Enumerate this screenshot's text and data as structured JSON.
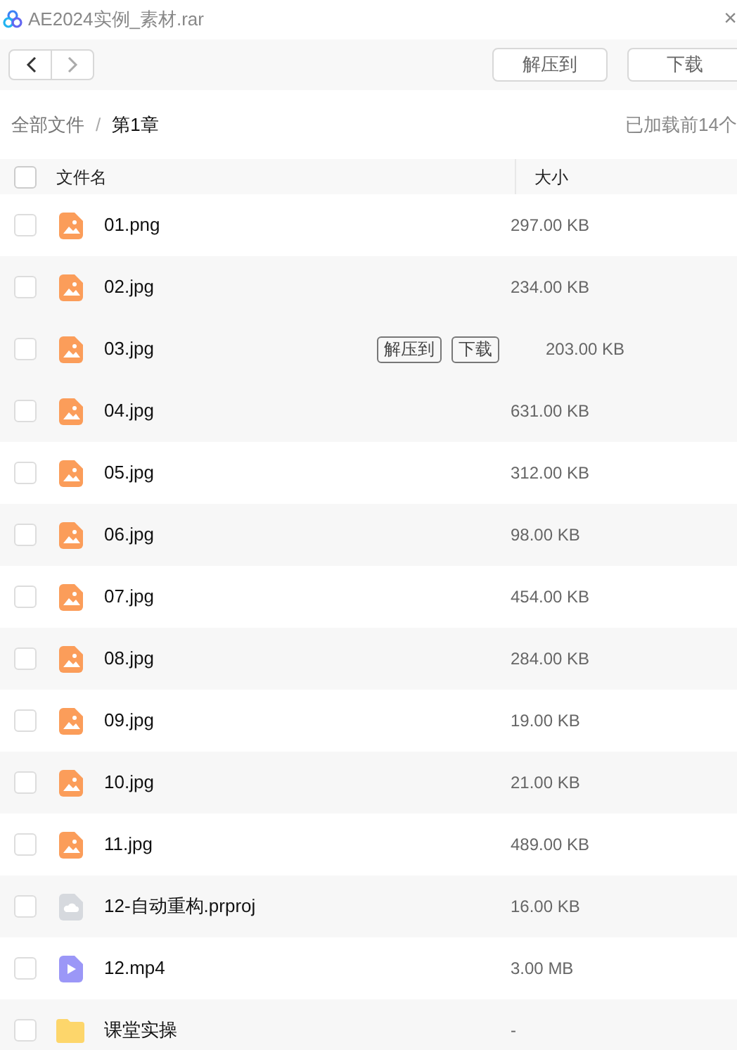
{
  "window": {
    "title": "AE2024实例_素材.rar",
    "close": "×"
  },
  "toolbar": {
    "buttons": [
      "解压到",
      "下载"
    ]
  },
  "breadcrumb": {
    "items": [
      "全部文件",
      "第1章"
    ],
    "separator": "/",
    "status": "已加载前14个"
  },
  "table": {
    "select_all_checked": false,
    "columns": [
      "文件名",
      "大小"
    ],
    "rows": [
      {
        "name": "01.png",
        "size": "297.00 KB",
        "kind": "image",
        "hovered": false
      },
      {
        "name": "02.jpg",
        "size": "234.00 KB",
        "kind": "image",
        "hovered": false
      },
      {
        "name": "03.jpg",
        "size": "203.00 KB",
        "kind": "image",
        "hovered": true,
        "actions": [
          "解压到",
          "下载"
        ]
      },
      {
        "name": "04.jpg",
        "size": "631.00 KB",
        "kind": "image",
        "hovered": false
      },
      {
        "name": "05.jpg",
        "size": "312.00 KB",
        "kind": "image",
        "hovered": false
      },
      {
        "name": "06.jpg",
        "size": "98.00 KB",
        "kind": "image",
        "hovered": false
      },
      {
        "name": "07.jpg",
        "size": "454.00 KB",
        "kind": "image",
        "hovered": false
      },
      {
        "name": "08.jpg",
        "size": "284.00 KB",
        "kind": "image",
        "hovered": false
      },
      {
        "name": "09.jpg",
        "size": "19.00 KB",
        "kind": "image",
        "hovered": false
      },
      {
        "name": "10.jpg",
        "size": "21.00 KB",
        "kind": "image",
        "hovered": false
      },
      {
        "name": "11.jpg",
        "size": "489.00 KB",
        "kind": "image",
        "hovered": false
      },
      {
        "name": "12-自动重构.prproj",
        "size": "16.00 KB",
        "kind": "project",
        "hovered": false
      },
      {
        "name": "12.mp4",
        "size": "3.00 MB",
        "kind": "video",
        "hovered": false
      },
      {
        "name": "课堂实操",
        "size": "-",
        "kind": "folder",
        "hovered": false
      }
    ]
  }
}
